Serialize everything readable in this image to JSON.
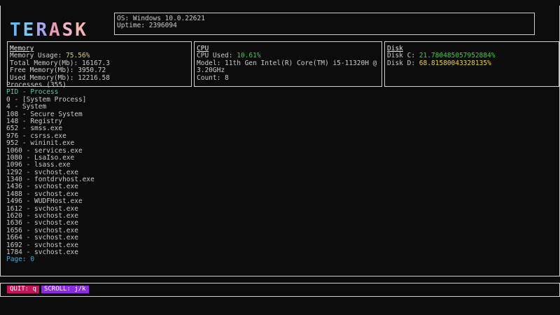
{
  "logo": {
    "letters": [
      "T",
      "E",
      "R",
      "A",
      "S",
      "K"
    ],
    "colors": [
      "#6fb8ea",
      "#7fc6ee",
      "#a9a5e8",
      "#e89ab6",
      "#f0b3c8",
      "#f0b8b0"
    ]
  },
  "system": {
    "os": "OS: Windows 10.0.22621",
    "uptime": "Uptime: 2396094"
  },
  "memory": {
    "title": "Memory",
    "usage_label": "Memory Usage: ",
    "usage_value": "75.56%",
    "total": "Total Memory(Mb): 16167.3",
    "free": "Free Memory(Mb): 3950.72",
    "used": "Used Memory(Mb): 12216.58"
  },
  "cpu": {
    "title": "CPU",
    "used_label": "CPU Used: ",
    "used_value": "10.61%",
    "model_line1": "Model: 11th Gen Intel(R) Core(TM) i5-11320H @",
    "model_line2": "3.20GHz",
    "count": "Count: 8"
  },
  "disk": {
    "title": "Disk",
    "c_label": "Disk C: ",
    "c_value": "21.780485057952884%",
    "d_label": "Disk D: ",
    "d_value": "68.81580043328135%"
  },
  "processes": {
    "title": "Processes (355)",
    "header": "PID - Process",
    "rows": [
      "0 - [System Process]",
      "4 - System",
      "108 - Secure System",
      "148 - Registry",
      "652 - smss.exe",
      "976 - csrss.exe",
      "952 - wininit.exe",
      "1060 - services.exe",
      "1080 - LsaIso.exe",
      "1096 - lsass.exe",
      "1292 - svchost.exe",
      "1340 - fontdrvhost.exe",
      "1436 - svchost.exe",
      "1488 - svchost.exe",
      "1496 - WUDFHost.exe",
      "1612 - svchost.exe",
      "1620 - svchost.exe",
      "1636 - svchost.exe",
      "1656 - svchost.exe",
      "1664 - svchost.exe",
      "1692 - svchost.exe",
      "1784 - svchost.exe"
    ],
    "page": "Page: 0"
  },
  "footer": {
    "quit": "QUIT: q",
    "scroll": "SCROLL: j/k"
  },
  "colors": {
    "background": "#0c0c0c",
    "green": "#3fd43f",
    "yellow": "#e6d35a",
    "teal": "#4fd0a8",
    "blue": "#4ea6d8",
    "quit_bg": "#c8145a",
    "scroll_bg": "#8b2be2"
  }
}
